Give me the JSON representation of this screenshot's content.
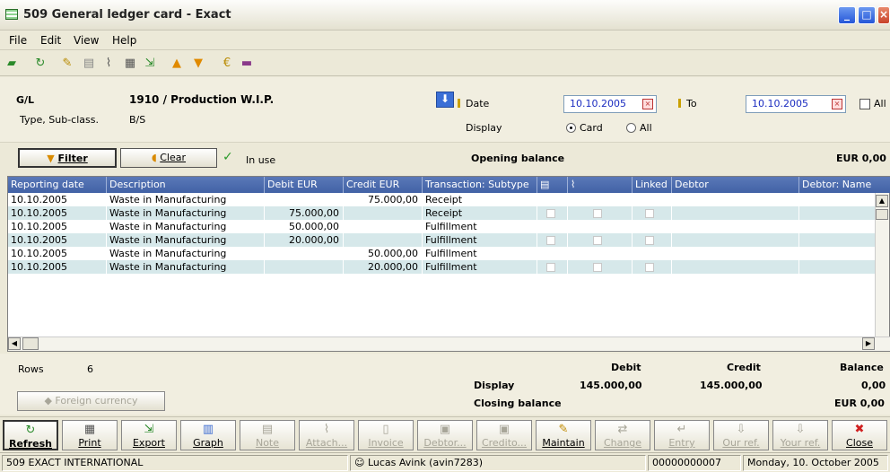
{
  "window": {
    "title": "509 General ledger card - Exact"
  },
  "menu": [
    "File",
    "Edit",
    "View",
    "Help"
  ],
  "header": {
    "gl_label": "G/L",
    "gl_value": "1910 / Production W.I.P.",
    "type_label": "Type, Sub-class.",
    "type_value": "B/S",
    "date_label": "Date",
    "date_value": "10.10.2005",
    "to_label": "To",
    "to_value": "10.10.2005",
    "all_label": "All",
    "display_label": "Display",
    "display_options": [
      "Card",
      "All"
    ]
  },
  "filterbar": {
    "filter_label": "Filter",
    "clear_label": "Clear",
    "in_use_label": "In use",
    "opening_balance_label": "Opening balance",
    "opening_balance_value": "EUR 0,00"
  },
  "grid": {
    "columns": [
      "Reporting date",
      "Description",
      "Debit EUR",
      "Credit EUR",
      "Transaction: Subtype",
      "",
      "",
      "Linked",
      "Debtor",
      "Debtor: Name"
    ],
    "rows": [
      {
        "date": "10.10.2005",
        "desc": "Waste in Manufacturing",
        "debit": "",
        "credit": "75.000,00",
        "subtype": "Receipt"
      },
      {
        "date": "10.10.2005",
        "desc": "Waste in Manufacturing",
        "debit": "75.000,00",
        "credit": "",
        "subtype": "Receipt"
      },
      {
        "date": "10.10.2005",
        "desc": "Waste in Manufacturing",
        "debit": "50.000,00",
        "credit": "",
        "subtype": "Fulfillment"
      },
      {
        "date": "10.10.2005",
        "desc": "Waste in Manufacturing",
        "debit": "20.000,00",
        "credit": "",
        "subtype": "Fulfillment"
      },
      {
        "date": "10.10.2005",
        "desc": "Waste in Manufacturing",
        "debit": "",
        "credit": "50.000,00",
        "subtype": "Fulfillment"
      },
      {
        "date": "10.10.2005",
        "desc": "Waste in Manufacturing",
        "debit": "",
        "credit": "20.000,00",
        "subtype": "Fulfillment"
      }
    ]
  },
  "summary": {
    "rows_label": "Rows",
    "rows_value": "6",
    "debit_label": "Debit",
    "credit_label": "Credit",
    "balance_label": "Balance",
    "display_label": "Display",
    "display_debit": "145.000,00",
    "display_credit": "145.000,00",
    "display_balance": "0,00",
    "closing_label": "Closing balance",
    "closing_value": "EUR 0,00",
    "foreign_currency_label": "Foreign currency"
  },
  "actions": [
    {
      "label": "Refresh",
      "icon": "refresh-icon",
      "enabled": true,
      "bold": true
    },
    {
      "label": "Print",
      "icon": "printer-icon",
      "enabled": true
    },
    {
      "label": "Export",
      "icon": "export-icon",
      "enabled": true
    },
    {
      "label": "Graph",
      "icon": "graph-icon",
      "enabled": true
    },
    {
      "label": "Note",
      "icon": "note-icon",
      "enabled": false
    },
    {
      "label": "Attach...",
      "icon": "paperclip-icon",
      "enabled": false
    },
    {
      "label": "Invoice",
      "icon": "invoice-icon",
      "enabled": false
    },
    {
      "label": "Debtor...",
      "icon": "debtor-icon",
      "enabled": false
    },
    {
      "label": "Credito...",
      "icon": "creditor-icon",
      "enabled": false
    },
    {
      "label": "Maintain",
      "icon": "pencil-icon",
      "enabled": true
    },
    {
      "label": "Change",
      "icon": "change-icon",
      "enabled": false
    },
    {
      "label": "Entry",
      "icon": "entry-icon",
      "enabled": false
    },
    {
      "label": "Our ref.",
      "icon": "our-ref-icon",
      "enabled": false
    },
    {
      "label": "Your ref.",
      "icon": "your-ref-icon",
      "enabled": false
    },
    {
      "label": "Close",
      "icon": "close-icon",
      "enabled": true
    }
  ],
  "status": {
    "company": "509 EXACT INTERNATIONAL",
    "user": "Lucas Avink (avin7283)",
    "code": "00000000007",
    "date": "Monday, 10. October 2005"
  }
}
